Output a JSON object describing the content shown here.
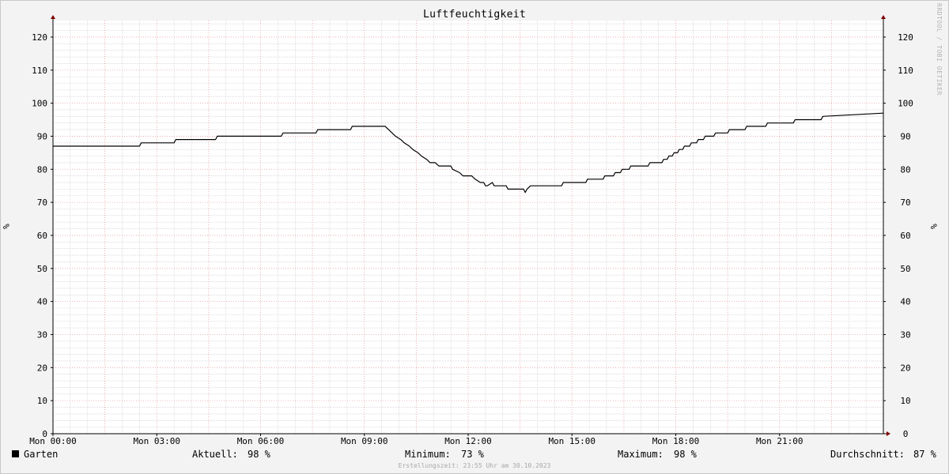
{
  "chart_data": {
    "type": "line",
    "title": "Luftfeuchtigkeit",
    "ylabel": "%",
    "ylim": [
      0,
      125
    ],
    "y_ticks": [
      0,
      10,
      20,
      30,
      40,
      50,
      60,
      70,
      80,
      90,
      100,
      110,
      120
    ],
    "x_tick_labels": [
      "Mon 00:00",
      "Mon 03:00",
      "Mon 06:00",
      "Mon 09:00",
      "Mon 12:00",
      "Mon 15:00",
      "Mon 18:00",
      "Mon 21:00"
    ],
    "x_tick_hours": [
      0,
      3,
      6,
      9,
      12,
      15,
      18,
      21
    ],
    "xlim_hours": [
      0,
      24
    ],
    "grid": true,
    "series": [
      {
        "name": "Garten",
        "color": "#000000",
        "x_hours": [
          0,
          2.5,
          2.55,
          3.5,
          3.55,
          4.7,
          4.75,
          6.6,
          6.65,
          7.6,
          7.65,
          8.6,
          8.65,
          8.9,
          8.95,
          9.6,
          9.7,
          9.8,
          9.9,
          10.05,
          10.15,
          10.3,
          10.4,
          10.55,
          10.65,
          10.8,
          10.9,
          11.05,
          11.15,
          11.5,
          11.55,
          11.75,
          11.85,
          12.1,
          12.2,
          12.35,
          12.45,
          12.5,
          12.55,
          12.7,
          12.75,
          13.1,
          13.15,
          13.6,
          13.65,
          13.7,
          13.8,
          13.9,
          14.0,
          14.7,
          14.75,
          15.4,
          15.45,
          15.9,
          15.95,
          16.2,
          16.25,
          16.4,
          16.45,
          16.65,
          16.7,
          17.2,
          17.25,
          17.6,
          17.65,
          17.75,
          17.8,
          17.9,
          17.95,
          18.05,
          18.1,
          18.2,
          18.25,
          18.4,
          18.45,
          18.6,
          18.65,
          18.8,
          18.85,
          19.1,
          19.15,
          19.5,
          19.55,
          20.0,
          20.05,
          20.6,
          20.65,
          21.4,
          21.45,
          22.2,
          22.25,
          24.0
        ],
        "y": [
          87,
          87,
          88,
          88,
          89,
          89,
          90,
          90,
          91,
          91,
          92,
          92,
          93,
          93,
          93,
          93,
          92,
          91,
          90,
          89,
          88,
          87,
          86,
          85,
          84,
          83,
          82,
          82,
          81,
          81,
          80,
          79,
          78,
          78,
          77,
          76,
          76,
          75,
          75,
          76,
          75,
          75,
          74,
          74,
          73,
          74,
          75,
          75,
          75,
          75,
          76,
          76,
          77,
          77,
          78,
          78,
          79,
          79,
          80,
          80,
          81,
          81,
          82,
          82,
          83,
          83,
          84,
          84,
          85,
          85,
          86,
          86,
          87,
          87,
          88,
          88,
          89,
          89,
          90,
          90,
          91,
          91,
          92,
          92,
          93,
          93,
          94,
          94,
          95,
          95,
          96,
          97,
          98
        ]
      }
    ]
  },
  "legend": {
    "series_name": "Garten",
    "aktuell_label": "Aktuell:",
    "aktuell_value": "98 %",
    "minimum_label": "Minimum:",
    "minimum_value": "73 %",
    "maximum_label": "Maximum:",
    "maximum_value": "98 %",
    "durchschnitt_label": "Durchschnitt:",
    "durchschnitt_value": "87 %"
  },
  "footer": "Erstellungszeit: 23:55 Uhr am 30.10.2023",
  "watermark": "RRDTOOL / TOBI OETIKER",
  "colors": {
    "background": "#f3f3f3",
    "plot_background": "#ffffff",
    "minor_grid": "#c8c8c8",
    "major_grid": "#e8a0a0",
    "axis": "#000000",
    "arrow": "#800000",
    "line": "#000000"
  }
}
